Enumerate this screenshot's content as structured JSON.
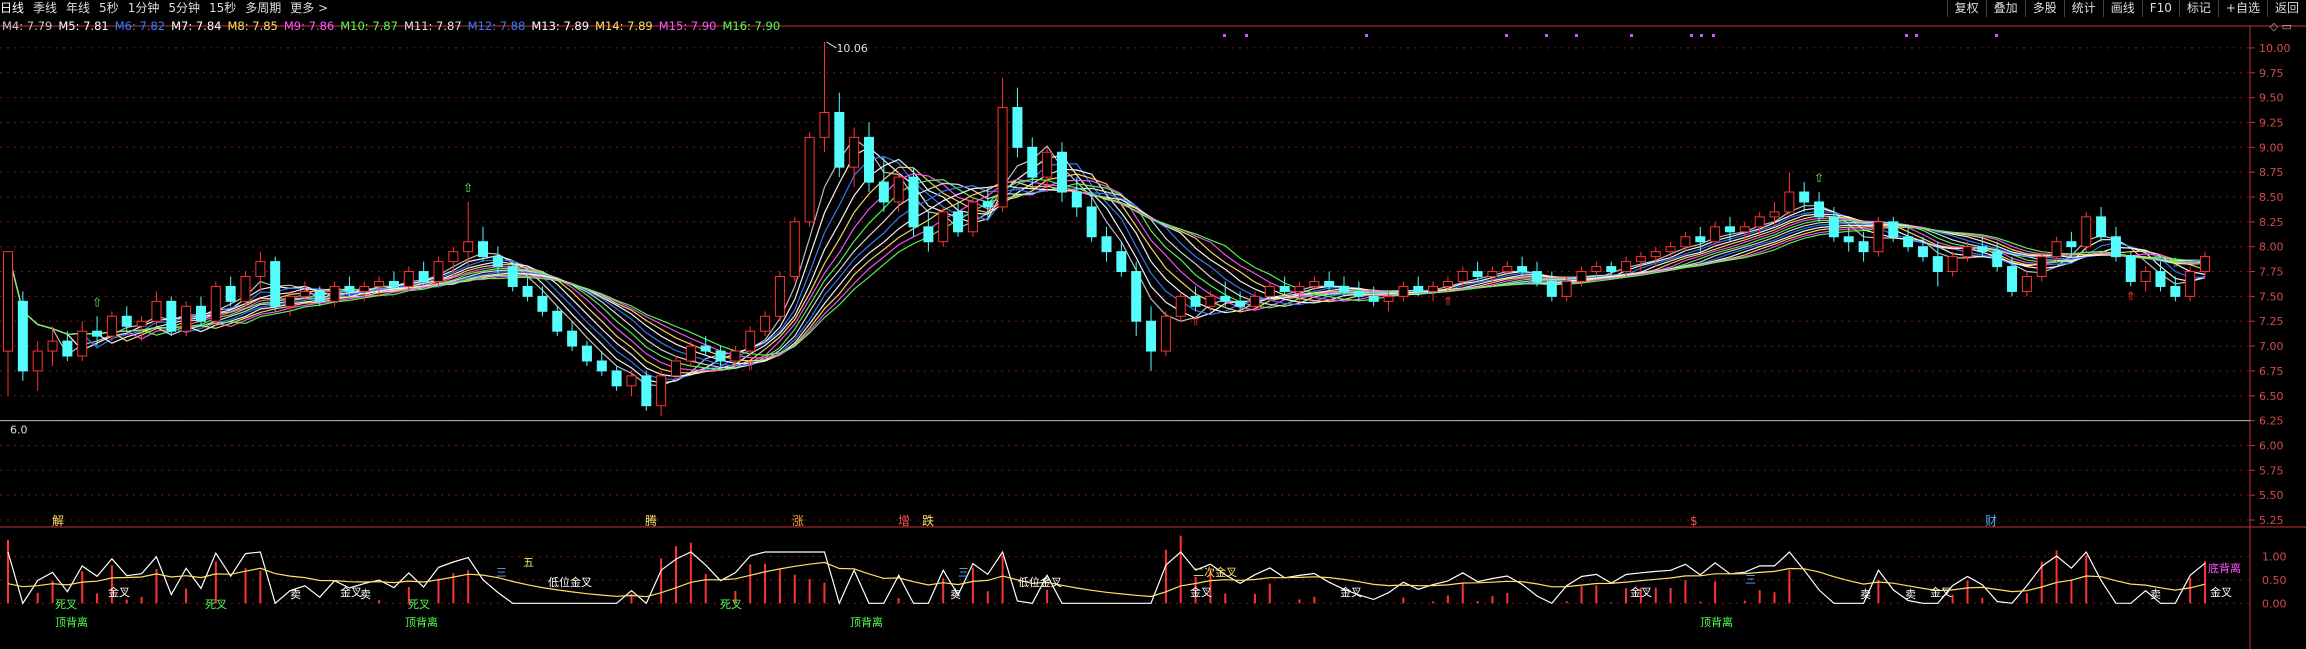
{
  "toolbar": {
    "timeframes": [
      "日线",
      "季线",
      "年线",
      "5秒",
      "1分钟",
      "5分钟",
      "15秒",
      "多周期",
      "更多 >"
    ],
    "active_timeframe": "日线",
    "buttons": [
      "复权",
      "叠加",
      "多股",
      "统计",
      "画线",
      "F10",
      "标记",
      "+自选",
      "返回"
    ]
  },
  "ma_legend": [
    {
      "label": "M4: 7.79",
      "color": "#c8c8c8"
    },
    {
      "label": "M5: 7.81",
      "color": "#ffffff"
    },
    {
      "label": "M6: 7.82",
      "color": "#3a7bff"
    },
    {
      "label": "M7: 7.84",
      "color": "#ffffff"
    },
    {
      "label": "M8: 7.85",
      "color": "#ffe066"
    },
    {
      "label": "M9: 7.86",
      "color": "#ff55ff"
    },
    {
      "label": "M10: 7.87",
      "color": "#55ff55"
    },
    {
      "label": "M11: 7.87",
      "color": "#e0e0e0"
    },
    {
      "label": "M12: 7.88",
      "color": "#3a7bff"
    },
    {
      "label": "M13: 7.89",
      "color": "#ffffff"
    },
    {
      "label": "M14: 7.89",
      "color": "#ffe066"
    },
    {
      "label": "M15: 7.90",
      "color": "#ff55ff"
    },
    {
      "label": "M16: 7.90",
      "color": "#55ff55"
    }
  ],
  "colors": {
    "up": "#ff3232",
    "down": "#54fcfc",
    "grid": "#7a1414",
    "axis": "#c83232",
    "macd_up": "#ff3232",
    "macd_down": "#32ff32"
  },
  "chart_data": {
    "type": "candlestick",
    "title": "",
    "xlabel": "",
    "ylabel": "",
    "ylim": [
      5.25,
      10.12
    ],
    "yticks": [
      "10.00",
      "9.75",
      "9.50",
      "9.25",
      "9.00",
      "8.75",
      "8.50",
      "8.25",
      "8.00",
      "7.75",
      "7.50",
      "7.25",
      "7.00",
      "6.75",
      "6.50",
      "6.25",
      "6.00",
      "5.75",
      "5.50",
      "5.25"
    ],
    "high_label": "10.06",
    "low_label": "6.0",
    "candles": [
      [
        6.95,
        7.95,
        6.5,
        7.95
      ],
      [
        7.45,
        7.55,
        6.65,
        6.75
      ],
      [
        6.75,
        7.05,
        6.55,
        6.95
      ],
      [
        6.95,
        7.2,
        6.8,
        7.05
      ],
      [
        7.05,
        7.15,
        6.85,
        6.9
      ],
      [
        6.9,
        7.25,
        6.85,
        7.15
      ],
      [
        7.15,
        7.3,
        7.0,
        7.1
      ],
      [
        7.1,
        7.35,
        7.05,
        7.3
      ],
      [
        7.3,
        7.4,
        7.15,
        7.2
      ],
      [
        7.2,
        7.3,
        7.05,
        7.25
      ],
      [
        7.25,
        7.55,
        7.2,
        7.45
      ],
      [
        7.45,
        7.5,
        7.1,
        7.15
      ],
      [
        7.15,
        7.45,
        7.1,
        7.4
      ],
      [
        7.4,
        7.5,
        7.2,
        7.25
      ],
      [
        7.25,
        7.65,
        7.2,
        7.6
      ],
      [
        7.6,
        7.7,
        7.4,
        7.45
      ],
      [
        7.45,
        7.75,
        7.4,
        7.7
      ],
      [
        7.7,
        7.95,
        7.55,
        7.85
      ],
      [
        7.85,
        7.9,
        7.35,
        7.4
      ],
      [
        7.4,
        7.55,
        7.3,
        7.5
      ],
      [
        7.5,
        7.65,
        7.45,
        7.55
      ],
      [
        7.55,
        7.6,
        7.4,
        7.45
      ],
      [
        7.45,
        7.65,
        7.4,
        7.6
      ],
      [
        7.6,
        7.7,
        7.5,
        7.55
      ],
      [
        7.55,
        7.65,
        7.45,
        7.6
      ],
      [
        7.6,
        7.7,
        7.5,
        7.65
      ],
      [
        7.65,
        7.75,
        7.55,
        7.6
      ],
      [
        7.6,
        7.8,
        7.55,
        7.75
      ],
      [
        7.75,
        7.85,
        7.6,
        7.65
      ],
      [
        7.65,
        7.9,
        7.6,
        7.85
      ],
      [
        7.85,
        8.0,
        7.7,
        7.95
      ],
      [
        7.95,
        8.45,
        7.8,
        8.05
      ],
      [
        8.05,
        8.2,
        7.85,
        7.9
      ],
      [
        7.9,
        8.0,
        7.7,
        7.8
      ],
      [
        7.8,
        7.85,
        7.55,
        7.6
      ],
      [
        7.6,
        7.7,
        7.45,
        7.5
      ],
      [
        7.5,
        7.6,
        7.3,
        7.35
      ],
      [
        7.35,
        7.4,
        7.1,
        7.15
      ],
      [
        7.15,
        7.25,
        6.95,
        7.0
      ],
      [
        7.0,
        7.05,
        6.8,
        6.85
      ],
      [
        6.85,
        6.95,
        6.7,
        6.75
      ],
      [
        6.75,
        6.8,
        6.55,
        6.6
      ],
      [
        6.6,
        6.75,
        6.5,
        6.7
      ],
      [
        6.7,
        6.75,
        6.35,
        6.4
      ],
      [
        6.4,
        6.75,
        6.3,
        6.7
      ],
      [
        6.7,
        6.9,
        6.65,
        6.85
      ],
      [
        6.85,
        7.05,
        6.8,
        7.0
      ],
      [
        7.0,
        7.1,
        6.9,
        6.95
      ],
      [
        6.95,
        7.0,
        6.8,
        6.85
      ],
      [
        6.85,
        7.0,
        6.8,
        6.95
      ],
      [
        6.95,
        7.2,
        6.9,
        7.15
      ],
      [
        7.15,
        7.35,
        7.1,
        7.3
      ],
      [
        7.3,
        7.75,
        7.25,
        7.7
      ],
      [
        7.7,
        8.3,
        7.65,
        8.25
      ],
      [
        8.25,
        9.15,
        8.2,
        9.1
      ],
      [
        9.1,
        10.06,
        8.95,
        9.35
      ],
      [
        9.35,
        9.55,
        8.7,
        8.8
      ],
      [
        8.8,
        9.2,
        8.6,
        9.1
      ],
      [
        9.1,
        9.25,
        8.55,
        8.65
      ],
      [
        8.65,
        8.9,
        8.35,
        8.45
      ],
      [
        8.45,
        8.75,
        8.35,
        8.7
      ],
      [
        8.7,
        8.8,
        8.1,
        8.2
      ],
      [
        8.2,
        8.35,
        7.95,
        8.05
      ],
      [
        8.05,
        8.4,
        8.0,
        8.35
      ],
      [
        8.35,
        8.45,
        8.1,
        8.15
      ],
      [
        8.15,
        8.5,
        8.1,
        8.45
      ],
      [
        8.45,
        8.6,
        8.3,
        8.4
      ],
      [
        8.4,
        9.7,
        8.35,
        9.4
      ],
      [
        9.4,
        9.6,
        8.9,
        9.0
      ],
      [
        9.0,
        9.1,
        8.6,
        8.7
      ],
      [
        8.7,
        9.0,
        8.55,
        8.95
      ],
      [
        8.95,
        9.05,
        8.45,
        8.55
      ],
      [
        8.55,
        8.7,
        8.3,
        8.4
      ],
      [
        8.4,
        8.55,
        8.05,
        8.1
      ],
      [
        8.1,
        8.2,
        7.85,
        7.95
      ],
      [
        7.95,
        8.05,
        7.7,
        7.75
      ],
      [
        7.75,
        7.85,
        7.1,
        7.25
      ],
      [
        7.25,
        7.4,
        6.75,
        6.95
      ],
      [
        6.95,
        7.35,
        6.9,
        7.3
      ],
      [
        7.3,
        7.55,
        7.25,
        7.5
      ],
      [
        7.5,
        7.6,
        7.35,
        7.4
      ],
      [
        7.4,
        7.55,
        7.35,
        7.5
      ],
      [
        7.5,
        7.65,
        7.4,
        7.45
      ],
      [
        7.45,
        7.55,
        7.35,
        7.4
      ],
      [
        7.4,
        7.55,
        7.35,
        7.5
      ],
      [
        7.5,
        7.65,
        7.45,
        7.6
      ],
      [
        7.6,
        7.7,
        7.5,
        7.55
      ],
      [
        7.55,
        7.65,
        7.45,
        7.6
      ],
      [
        7.6,
        7.7,
        7.55,
        7.65
      ],
      [
        7.65,
        7.75,
        7.55,
        7.6
      ],
      [
        7.6,
        7.7,
        7.5,
        7.55
      ],
      [
        7.55,
        7.65,
        7.45,
        7.5
      ],
      [
        7.5,
        7.6,
        7.4,
        7.45
      ],
      [
        7.45,
        7.55,
        7.35,
        7.5
      ],
      [
        7.5,
        7.65,
        7.45,
        7.6
      ],
      [
        7.6,
        7.7,
        7.5,
        7.55
      ],
      [
        7.55,
        7.65,
        7.45,
        7.6
      ],
      [
        7.6,
        7.7,
        7.55,
        7.65
      ],
      [
        7.65,
        7.8,
        7.6,
        7.75
      ],
      [
        7.75,
        7.85,
        7.65,
        7.7
      ],
      [
        7.7,
        7.8,
        7.6,
        7.75
      ],
      [
        7.75,
        7.85,
        7.7,
        7.8
      ],
      [
        7.8,
        7.9,
        7.7,
        7.75
      ],
      [
        7.75,
        7.85,
        7.6,
        7.65
      ],
      [
        7.65,
        7.75,
        7.45,
        7.5
      ],
      [
        7.5,
        7.7,
        7.45,
        7.65
      ],
      [
        7.65,
        7.8,
        7.6,
        7.75
      ],
      [
        7.75,
        7.85,
        7.7,
        7.8
      ],
      [
        7.8,
        7.85,
        7.7,
        7.75
      ],
      [
        7.75,
        7.9,
        7.7,
        7.85
      ],
      [
        7.85,
        7.95,
        7.75,
        7.9
      ],
      [
        7.9,
        8.0,
        7.8,
        7.95
      ],
      [
        7.95,
        8.05,
        7.85,
        8.0
      ],
      [
        8.0,
        8.15,
        7.95,
        8.1
      ],
      [
        8.1,
        8.2,
        7.95,
        8.05
      ],
      [
        8.05,
        8.25,
        8.0,
        8.2
      ],
      [
        8.2,
        8.3,
        8.05,
        8.15
      ],
      [
        8.15,
        8.25,
        8.05,
        8.2
      ],
      [
        8.2,
        8.35,
        8.1,
        8.3
      ],
      [
        8.3,
        8.45,
        8.2,
        8.35
      ],
      [
        8.35,
        8.75,
        8.3,
        8.55
      ],
      [
        8.55,
        8.65,
        8.35,
        8.45
      ],
      [
        8.45,
        8.55,
        8.25,
        8.3
      ],
      [
        8.3,
        8.4,
        8.05,
        8.1
      ],
      [
        8.1,
        8.2,
        7.95,
        8.05
      ],
      [
        8.05,
        8.15,
        7.85,
        7.95
      ],
      [
        7.95,
        8.3,
        7.9,
        8.25
      ],
      [
        8.25,
        8.3,
        8.05,
        8.1
      ],
      [
        8.1,
        8.2,
        7.95,
        8.0
      ],
      [
        8.0,
        8.1,
        7.85,
        7.9
      ],
      [
        7.9,
        8.05,
        7.6,
        7.75
      ],
      [
        7.75,
        7.95,
        7.7,
        7.9
      ],
      [
        7.9,
        8.05,
        7.85,
        8.0
      ],
      [
        8.0,
        8.1,
        7.9,
        7.95
      ],
      [
        7.95,
        8.05,
        7.75,
        7.8
      ],
      [
        7.8,
        7.9,
        7.5,
        7.55
      ],
      [
        7.55,
        7.75,
        7.5,
        7.7
      ],
      [
        7.7,
        7.95,
        7.65,
        7.9
      ],
      [
        7.9,
        8.1,
        7.85,
        8.05
      ],
      [
        8.05,
        8.15,
        7.9,
        8.0
      ],
      [
        8.0,
        8.35,
        7.95,
        8.3
      ],
      [
        8.3,
        8.4,
        8.05,
        8.1
      ],
      [
        8.1,
        8.2,
        7.85,
        7.9
      ],
      [
        7.9,
        7.95,
        7.6,
        7.65
      ],
      [
        7.65,
        7.8,
        7.55,
        7.75
      ],
      [
        7.75,
        7.85,
        7.55,
        7.6
      ],
      [
        7.6,
        7.7,
        7.45,
        7.5
      ],
      [
        7.5,
        7.8,
        7.45,
        7.75
      ],
      [
        7.75,
        7.95,
        7.7,
        7.9
      ]
    ],
    "ma_periods": [
      4,
      5,
      6,
      7,
      8,
      9,
      10,
      11,
      12,
      13,
      14,
      15,
      16
    ],
    "ma_last": [
      7.79,
      7.81,
      7.82,
      7.84,
      7.85,
      7.86,
      7.87,
      7.87,
      7.88,
      7.89,
      7.89,
      7.9,
      7.9
    ],
    "annotations": [
      "解",
      "腾",
      "涨",
      "增",
      "跌",
      "$",
      "财"
    ],
    "indicator": {
      "ylim": [
        -0.1,
        1.25
      ],
      "yticks": [
        "1.00",
        "0.50",
        "0.00"
      ],
      "labels": [
        "死叉",
        "死叉",
        "死叉",
        "死叉",
        "金叉",
        "金叉",
        "金叉",
        "金叉",
        "金叉",
        "金叉",
        "金叉",
        "二次金叉",
        "低位金叉",
        "低位金叉",
        "底背离",
        "顶背离",
        "顶背离",
        "顶背离",
        "顶背离",
        "三",
        "三",
        "三",
        "五",
        "卖",
        "卖",
        "卖",
        "卖",
        "卖",
        "卖"
      ]
    }
  }
}
